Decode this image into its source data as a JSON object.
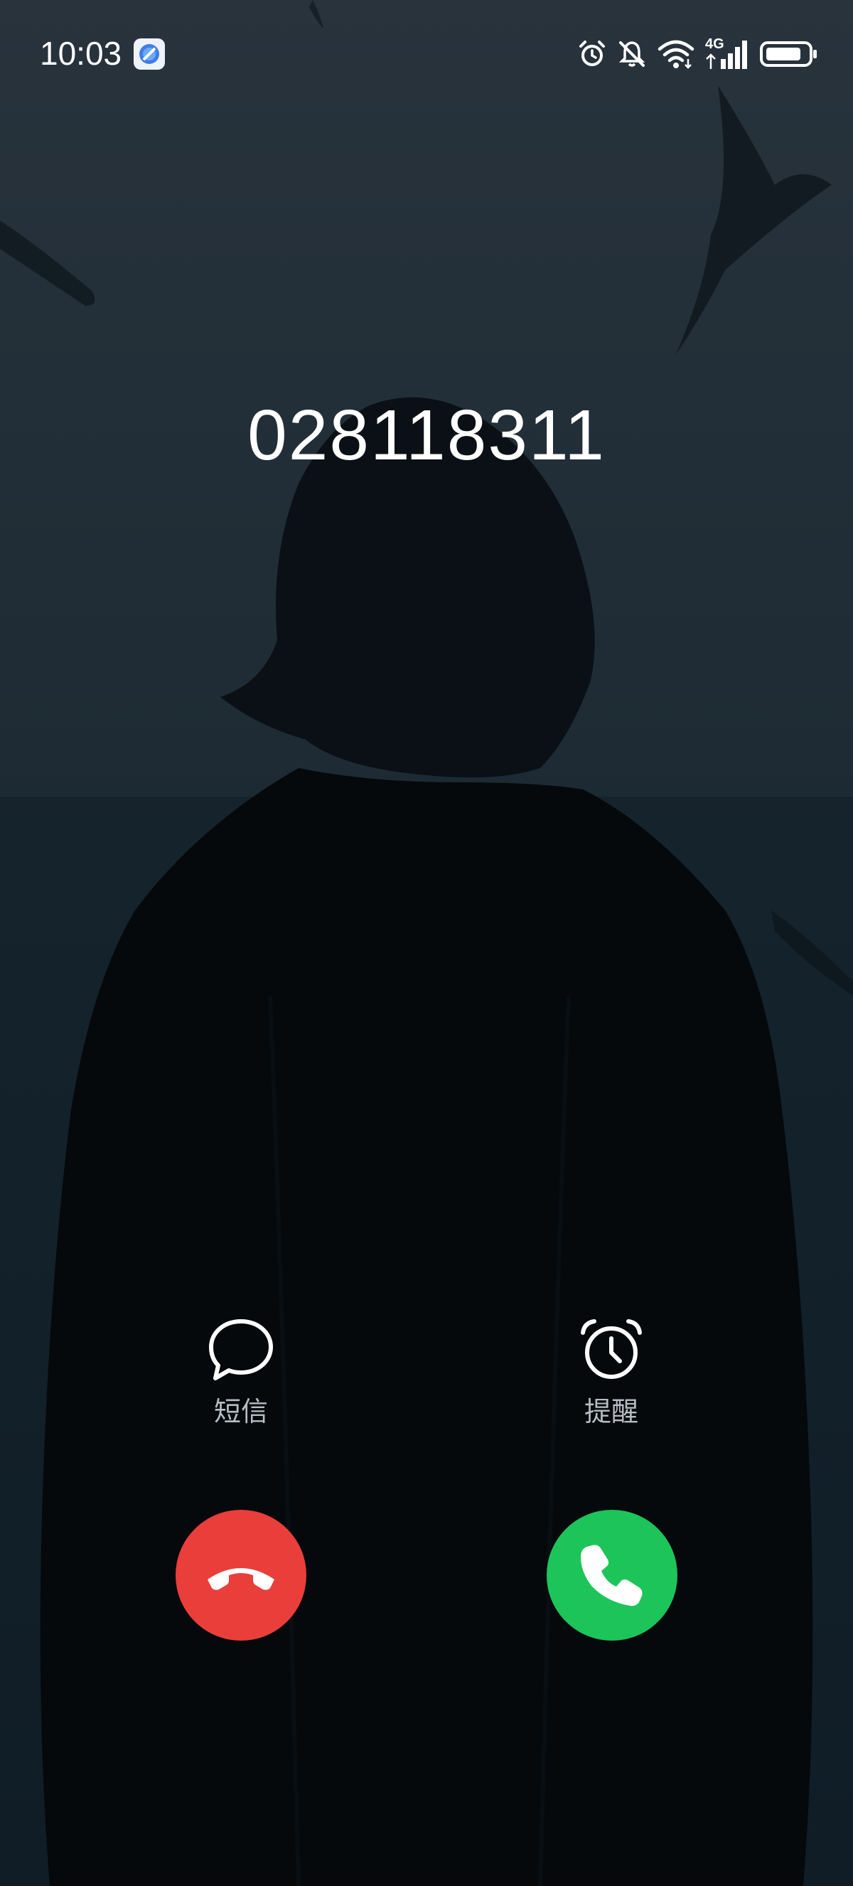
{
  "status_bar": {
    "time": "10:03",
    "network_label": "4G"
  },
  "call": {
    "caller_number": "028118311"
  },
  "actions": {
    "message_label": "短信",
    "remind_label": "提醒"
  },
  "colors": {
    "decline": "#ea3e3b",
    "answer": "#1dc45a",
    "label": "#b7bdc3"
  },
  "icons": {
    "message": "speech-bubble-icon",
    "remind": "alarm-clock-icon",
    "decline": "phone-hangup-icon",
    "answer": "phone-icon"
  }
}
